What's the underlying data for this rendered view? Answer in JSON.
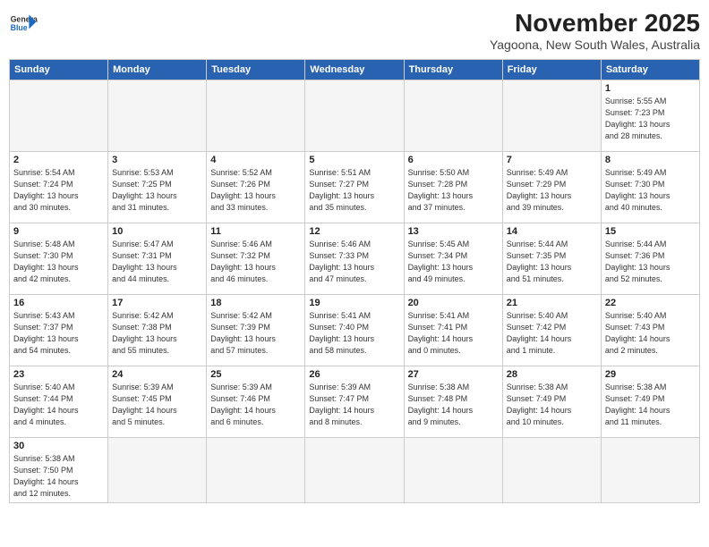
{
  "header": {
    "logo_general": "General",
    "logo_blue": "Blue",
    "month_title": "November 2025",
    "subtitle": "Yagoona, New South Wales, Australia"
  },
  "days_of_week": [
    "Sunday",
    "Monday",
    "Tuesday",
    "Wednesday",
    "Thursday",
    "Friday",
    "Saturday"
  ],
  "weeks": [
    [
      {
        "day": "",
        "info": ""
      },
      {
        "day": "",
        "info": ""
      },
      {
        "day": "",
        "info": ""
      },
      {
        "day": "",
        "info": ""
      },
      {
        "day": "",
        "info": ""
      },
      {
        "day": "",
        "info": ""
      },
      {
        "day": "1",
        "info": "Sunrise: 5:55 AM\nSunset: 7:23 PM\nDaylight: 13 hours\nand 28 minutes."
      }
    ],
    [
      {
        "day": "2",
        "info": "Sunrise: 5:54 AM\nSunset: 7:24 PM\nDaylight: 13 hours\nand 30 minutes."
      },
      {
        "day": "3",
        "info": "Sunrise: 5:53 AM\nSunset: 7:25 PM\nDaylight: 13 hours\nand 31 minutes."
      },
      {
        "day": "4",
        "info": "Sunrise: 5:52 AM\nSunset: 7:26 PM\nDaylight: 13 hours\nand 33 minutes."
      },
      {
        "day": "5",
        "info": "Sunrise: 5:51 AM\nSunset: 7:27 PM\nDaylight: 13 hours\nand 35 minutes."
      },
      {
        "day": "6",
        "info": "Sunrise: 5:50 AM\nSunset: 7:28 PM\nDaylight: 13 hours\nand 37 minutes."
      },
      {
        "day": "7",
        "info": "Sunrise: 5:49 AM\nSunset: 7:29 PM\nDaylight: 13 hours\nand 39 minutes."
      },
      {
        "day": "8",
        "info": "Sunrise: 5:49 AM\nSunset: 7:30 PM\nDaylight: 13 hours\nand 40 minutes."
      }
    ],
    [
      {
        "day": "9",
        "info": "Sunrise: 5:48 AM\nSunset: 7:30 PM\nDaylight: 13 hours\nand 42 minutes."
      },
      {
        "day": "10",
        "info": "Sunrise: 5:47 AM\nSunset: 7:31 PM\nDaylight: 13 hours\nand 44 minutes."
      },
      {
        "day": "11",
        "info": "Sunrise: 5:46 AM\nSunset: 7:32 PM\nDaylight: 13 hours\nand 46 minutes."
      },
      {
        "day": "12",
        "info": "Sunrise: 5:46 AM\nSunset: 7:33 PM\nDaylight: 13 hours\nand 47 minutes."
      },
      {
        "day": "13",
        "info": "Sunrise: 5:45 AM\nSunset: 7:34 PM\nDaylight: 13 hours\nand 49 minutes."
      },
      {
        "day": "14",
        "info": "Sunrise: 5:44 AM\nSunset: 7:35 PM\nDaylight: 13 hours\nand 51 minutes."
      },
      {
        "day": "15",
        "info": "Sunrise: 5:44 AM\nSunset: 7:36 PM\nDaylight: 13 hours\nand 52 minutes."
      }
    ],
    [
      {
        "day": "16",
        "info": "Sunrise: 5:43 AM\nSunset: 7:37 PM\nDaylight: 13 hours\nand 54 minutes."
      },
      {
        "day": "17",
        "info": "Sunrise: 5:42 AM\nSunset: 7:38 PM\nDaylight: 13 hours\nand 55 minutes."
      },
      {
        "day": "18",
        "info": "Sunrise: 5:42 AM\nSunset: 7:39 PM\nDaylight: 13 hours\nand 57 minutes."
      },
      {
        "day": "19",
        "info": "Sunrise: 5:41 AM\nSunset: 7:40 PM\nDaylight: 13 hours\nand 58 minutes."
      },
      {
        "day": "20",
        "info": "Sunrise: 5:41 AM\nSunset: 7:41 PM\nDaylight: 14 hours\nand 0 minutes."
      },
      {
        "day": "21",
        "info": "Sunrise: 5:40 AM\nSunset: 7:42 PM\nDaylight: 14 hours\nand 1 minute."
      },
      {
        "day": "22",
        "info": "Sunrise: 5:40 AM\nSunset: 7:43 PM\nDaylight: 14 hours\nand 2 minutes."
      }
    ],
    [
      {
        "day": "23",
        "info": "Sunrise: 5:40 AM\nSunset: 7:44 PM\nDaylight: 14 hours\nand 4 minutes."
      },
      {
        "day": "24",
        "info": "Sunrise: 5:39 AM\nSunset: 7:45 PM\nDaylight: 14 hours\nand 5 minutes."
      },
      {
        "day": "25",
        "info": "Sunrise: 5:39 AM\nSunset: 7:46 PM\nDaylight: 14 hours\nand 6 minutes."
      },
      {
        "day": "26",
        "info": "Sunrise: 5:39 AM\nSunset: 7:47 PM\nDaylight: 14 hours\nand 8 minutes."
      },
      {
        "day": "27",
        "info": "Sunrise: 5:38 AM\nSunset: 7:48 PM\nDaylight: 14 hours\nand 9 minutes."
      },
      {
        "day": "28",
        "info": "Sunrise: 5:38 AM\nSunset: 7:49 PM\nDaylight: 14 hours\nand 10 minutes."
      },
      {
        "day": "29",
        "info": "Sunrise: 5:38 AM\nSunset: 7:49 PM\nDaylight: 14 hours\nand 11 minutes."
      }
    ],
    [
      {
        "day": "30",
        "info": "Sunrise: 5:38 AM\nSunset: 7:50 PM\nDaylight: 14 hours\nand 12 minutes."
      },
      {
        "day": "",
        "info": ""
      },
      {
        "day": "",
        "info": ""
      },
      {
        "day": "",
        "info": ""
      },
      {
        "day": "",
        "info": ""
      },
      {
        "day": "",
        "info": ""
      },
      {
        "day": "",
        "info": ""
      }
    ]
  ]
}
